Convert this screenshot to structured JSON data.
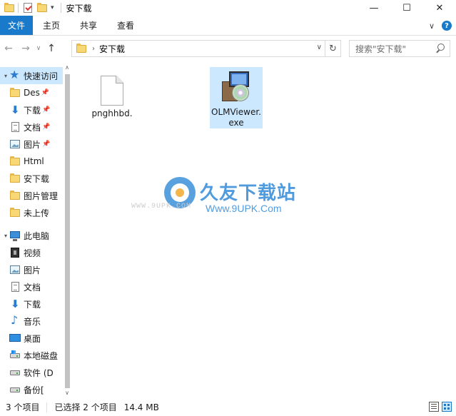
{
  "window": {
    "title": "安下载",
    "qat_dropdown": "▾",
    "controls": {
      "minimize": "—",
      "maximize": "☐",
      "close": "✕"
    }
  },
  "ribbon": {
    "tabs": [
      {
        "label": "文件"
      },
      {
        "label": "主页"
      },
      {
        "label": "共享"
      },
      {
        "label": "查看"
      }
    ],
    "collapse": "∨",
    "help": "?"
  },
  "address": {
    "back": "←",
    "forward": "→",
    "recent": "∨",
    "up": "↑",
    "separator": "›",
    "path": "安下载",
    "dropdown": "∨",
    "refresh": "↻"
  },
  "search": {
    "placeholder": "搜索\"安下载\""
  },
  "nav": {
    "items": [
      {
        "label": "快速访问",
        "icon": "star-icon",
        "expandable": true,
        "selected": true
      },
      {
        "label": "Des",
        "icon": "folder-icon",
        "pinned": true
      },
      {
        "label": "下载",
        "icon": "download-icon",
        "pinned": true
      },
      {
        "label": "文档",
        "icon": "document-icon",
        "pinned": true
      },
      {
        "label": "图片",
        "icon": "picture-icon",
        "pinned": true
      },
      {
        "label": "Html",
        "icon": "folder-icon"
      },
      {
        "label": "安下载",
        "icon": "folder-icon"
      },
      {
        "label": "图片管理",
        "icon": "folder-icon"
      },
      {
        "label": "未上传",
        "icon": "folder-icon"
      },
      {
        "label": "此电脑",
        "icon": "pc-icon",
        "expandable": true
      },
      {
        "label": "视频",
        "icon": "video-icon"
      },
      {
        "label": "图片",
        "icon": "picture-icon"
      },
      {
        "label": "文档",
        "icon": "document-icon"
      },
      {
        "label": "下载",
        "icon": "download-icon"
      },
      {
        "label": "音乐",
        "icon": "music-icon"
      },
      {
        "label": "桌面",
        "icon": "desktop-icon"
      },
      {
        "label": "本地磁盘",
        "icon": "drive-icon"
      },
      {
        "label": "软件 (D",
        "icon": "drive-icon"
      },
      {
        "label": "备份[",
        "icon": "drive-icon"
      }
    ],
    "pin_glyph": "📌",
    "expand_glyph": "▾",
    "collapse_glyph": "▸",
    "scroll_up": "∧",
    "scroll_down": "∨"
  },
  "files": [
    {
      "name": "pnghhbd.",
      "type": "blank-file-icon",
      "selected": false
    },
    {
      "name": "OLMViewer.exe",
      "type": "installer-exe-icon",
      "selected": true
    }
  ],
  "watermark": {
    "brand": "久友下载站",
    "url": "Www.9UPK.Com",
    "ghost": "WWW.9UPK.COM"
  },
  "status": {
    "item_count": "3 个项目",
    "selection": "已选择 2 个项目",
    "size": "14.4 MB"
  },
  "colors": {
    "accent": "#1979ca",
    "selection": "#cce8ff",
    "folder": "#f8d775",
    "watermark": "#1f7fd6"
  }
}
